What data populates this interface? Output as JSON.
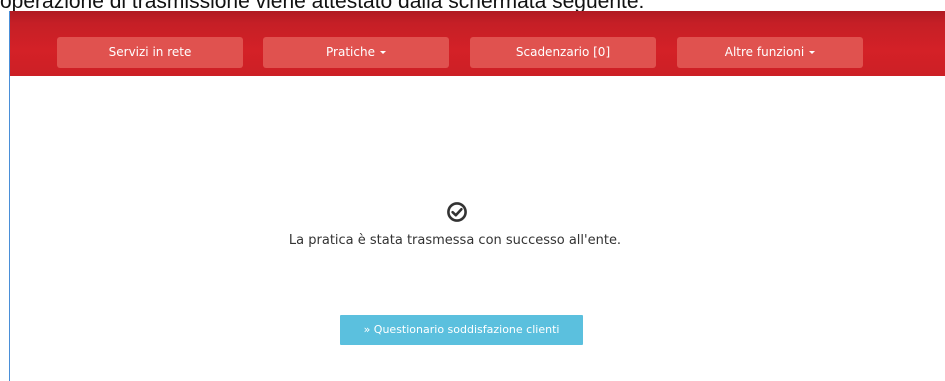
{
  "caption": {
    "text": "operazione di trasmissione viene attestato dalla schermata seguente:"
  },
  "navbar": {
    "items": [
      {
        "label": "Servizi in rete",
        "has_caret": false
      },
      {
        "label": "Pratiche",
        "has_caret": true
      },
      {
        "label": "Scadenzario [0]",
        "has_caret": false
      },
      {
        "label": "Altre funzioni",
        "has_caret": true
      }
    ]
  },
  "main": {
    "status_icon": "check-circle-icon",
    "success_message": "La pratica è stata trasmessa con successo all'ente.",
    "survey_button": {
      "icon": "»",
      "label": "Questionario soddisfazione clienti"
    }
  },
  "colors": {
    "navbar_bg": "#d42127",
    "nav_button_bg": "#e0524f",
    "survey_button_bg": "#5bc0de",
    "frame_border": "#4a8fd8"
  }
}
